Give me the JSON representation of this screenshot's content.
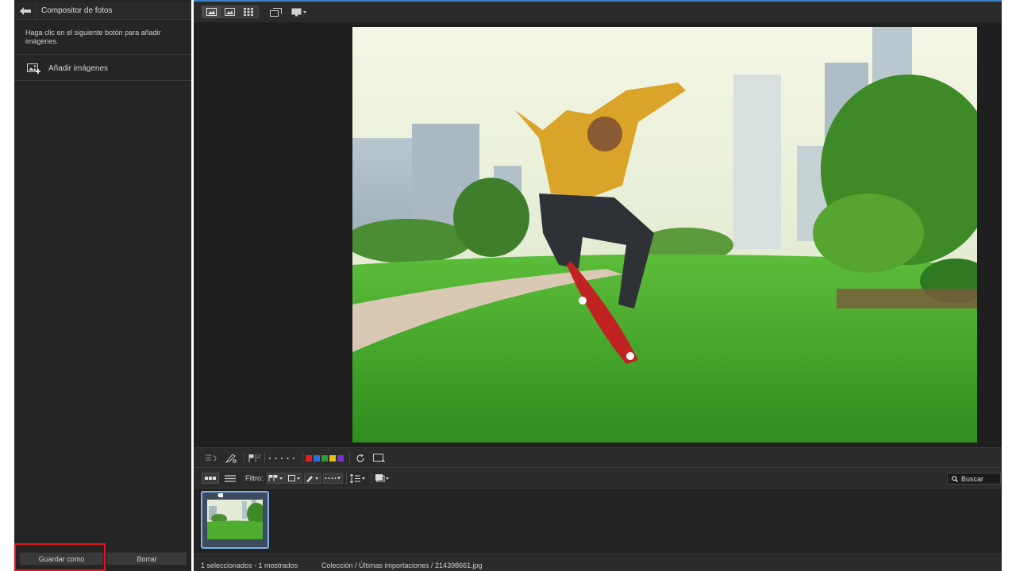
{
  "panel": {
    "title": "Compositor de fotos",
    "description": "Haga clic en el siguiente botón para añadir imágenes.",
    "add_images_label": "Añadir imágenes",
    "save_as_label": "Guardar como",
    "delete_label": "Borrar"
  },
  "toolbar": {
    "view_buttons": [
      "single-view-icon",
      "compare-view-icon",
      "grid-view-icon",
      "second-screen-icon",
      "display-icon"
    ]
  },
  "filter_bar": {
    "filter_label": "Filtro:",
    "search_label": "Buscar"
  },
  "label_colors": [
    "#e02020",
    "#2f6fe0",
    "#2f9e3a",
    "#e2c21a",
    "#7a2fd0"
  ],
  "status": {
    "selection": "1 seleccionados - 1 mostrados",
    "path": "Colección / Últimas importaciones / 214398661.jpg"
  },
  "accent_color": "#3d7fc6",
  "highlight_color": "#e0141e"
}
